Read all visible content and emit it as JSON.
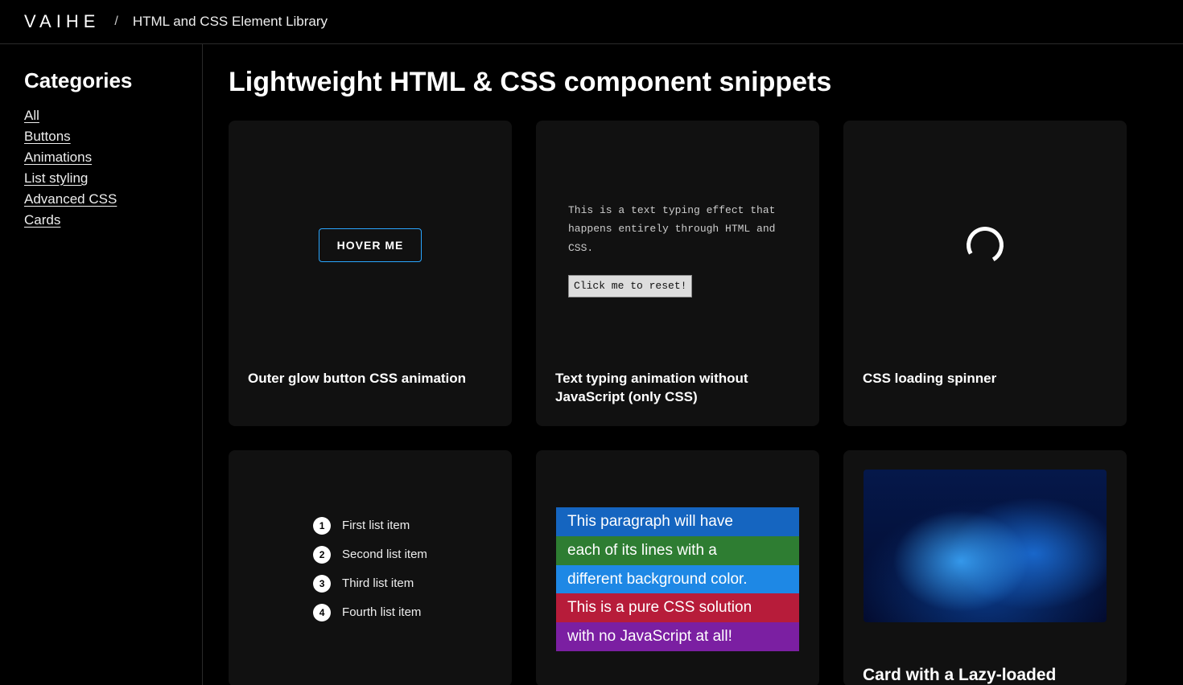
{
  "header": {
    "logo": "VAIHE",
    "separator": "/",
    "breadcrumb": "HTML and CSS Element Library"
  },
  "sidebar": {
    "title": "Categories",
    "items": [
      "All",
      "Buttons",
      "Animations",
      "List styling",
      "Advanced CSS",
      "Cards"
    ]
  },
  "main": {
    "heading": "Lightweight HTML & CSS component snippets",
    "cards": [
      {
        "title": "Outer glow button CSS animation",
        "demo": {
          "button_label": "HOVER ME"
        }
      },
      {
        "title": "Text typing animation without JavaScript (only CSS)",
        "demo": {
          "text": "This is a text typing effect that happens entirely through HTML and CSS.",
          "reset_label": "Click me to reset!"
        }
      },
      {
        "title": "CSS loading spinner",
        "demo": {
          "icon": "spinner-icon"
        }
      },
      {
        "title": "",
        "demo": {
          "items": [
            "First list item",
            "Second list item",
            "Third list item",
            "Fourth list item"
          ]
        }
      },
      {
        "title": "",
        "demo": {
          "lines": [
            "This paragraph will have",
            "each of its lines with a",
            "different background color.",
            "This is a pure CSS solution",
            "with no JavaScript at all!"
          ],
          "colors": [
            "#1565c0",
            "#2e7d32",
            "#1e88e5",
            "#b71c3a",
            "#7b1fa2"
          ]
        }
      },
      {
        "title": "Card with a Lazy-loaded",
        "demo": {
          "image": "abstract-blue-waves"
        }
      }
    ]
  }
}
